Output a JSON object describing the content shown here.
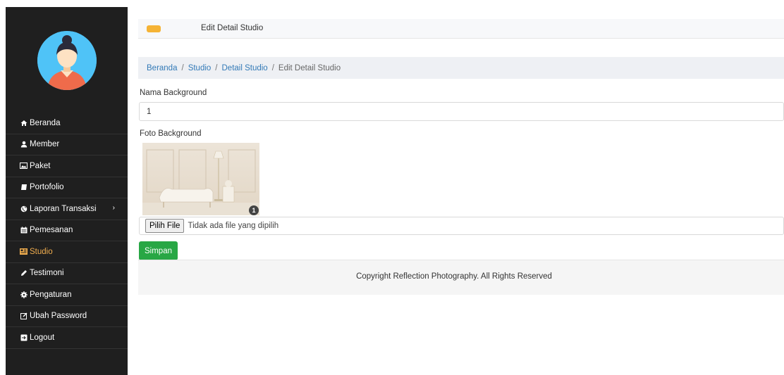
{
  "sidebar": {
    "items": [
      {
        "label": "Beranda",
        "icon": "home-icon"
      },
      {
        "label": "Member",
        "icon": "user-icon"
      },
      {
        "label": "Paket",
        "icon": "image-icon"
      },
      {
        "label": "Portofolio",
        "icon": "book-icon"
      },
      {
        "label": "Laporan Transaksi",
        "icon": "globe-icon",
        "has_submenu": true
      },
      {
        "label": "Pemesanan",
        "icon": "calendar-icon"
      },
      {
        "label": "Studio",
        "icon": "studio-icon",
        "active": true
      },
      {
        "label": "Testimoni",
        "icon": "pencil-icon"
      },
      {
        "label": "Pengaturan",
        "icon": "cog-icon"
      },
      {
        "label": "Ubah Password",
        "icon": "edit-icon"
      },
      {
        "label": "Logout",
        "icon": "logout-icon"
      }
    ],
    "active_color": "#f0ad4e"
  },
  "header": {
    "title": "Edit Detail Studio",
    "toggle_color": "#f5b335"
  },
  "breadcrumb": {
    "items": [
      "Beranda",
      "Studio",
      "Detail Studio"
    ],
    "current": "Edit Detail Studio",
    "separator": "/"
  },
  "form": {
    "name_label": "Nama Background",
    "name_value": "1",
    "photo_label": "Foto Background",
    "photo_badge": "1",
    "file_button": "Pilih File",
    "file_status": "Tidak ada file yang dipilih",
    "submit_label": "Simpan",
    "submit_color": "#28a745"
  },
  "footer": {
    "text": "Copyright Reflection Photography. All Rights Reserved"
  }
}
